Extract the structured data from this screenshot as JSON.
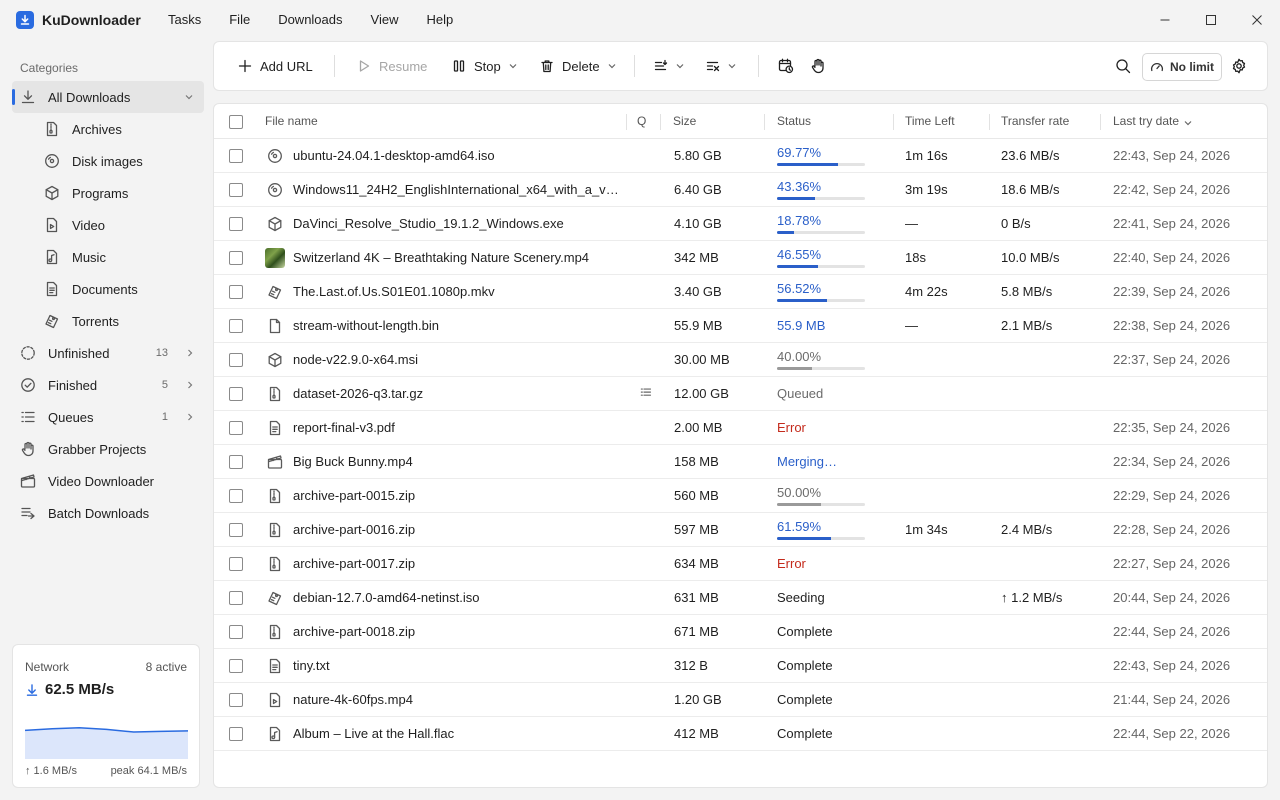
{
  "app": {
    "title": "KuDownloader"
  },
  "menu": [
    "Tasks",
    "File",
    "Downloads",
    "View",
    "Help"
  ],
  "sidebar": {
    "heading": "Categories",
    "items": [
      {
        "label": "All Downloads",
        "icon": "download-icon",
        "active": true,
        "expanded": true
      },
      {
        "label": "Archives",
        "icon": "archive-icon",
        "sub": true
      },
      {
        "label": "Disk images",
        "icon": "disc-icon",
        "sub": true
      },
      {
        "label": "Programs",
        "icon": "package-icon",
        "sub": true
      },
      {
        "label": "Video",
        "icon": "video-icon",
        "sub": true
      },
      {
        "label": "Music",
        "icon": "music-icon",
        "sub": true
      },
      {
        "label": "Documents",
        "icon": "document-icon",
        "sub": true
      },
      {
        "label": "Torrents",
        "icon": "torrent-icon",
        "sub": true
      },
      {
        "label": "Unfinished",
        "icon": "unfinished-icon",
        "count": "13",
        "chevron": true
      },
      {
        "label": "Finished",
        "icon": "check-circle-icon",
        "count": "5",
        "chevron": true
      },
      {
        "label": "Queues",
        "icon": "queue-icon",
        "count": "1",
        "chevron": true
      },
      {
        "label": "Grabber Projects",
        "icon": "grab-hand-icon"
      },
      {
        "label": "Video Downloader",
        "icon": "clapper-icon"
      },
      {
        "label": "Batch Downloads",
        "icon": "batch-icon"
      }
    ]
  },
  "network": {
    "title": "Network",
    "active": "8 active",
    "speed": "62.5 MB/s",
    "upload": "↑ 1.6 MB/s",
    "peak": "peak 64.1 MB/s",
    "graph": [
      0.55,
      0.58,
      0.6,
      0.57,
      0.52,
      0.53,
      0.54
    ],
    "accent": "#2a6be0"
  },
  "toolbar": {
    "add_url": "Add URL",
    "resume": "Resume",
    "stop": "Stop",
    "delete": "Delete",
    "speed_limit": "No limit"
  },
  "table": {
    "columns": {
      "name": "File name",
      "queue": "Q",
      "size": "Size",
      "status": "Status",
      "time_left": "Time Left",
      "rate": "Transfer rate",
      "date": "Last try date"
    },
    "rows": [
      {
        "name": "ubuntu-24.04.1-desktop-amd64.iso",
        "icon": "disc-icon",
        "size": "5.80 GB",
        "status": "69.77%",
        "kind": "progress",
        "progress": 0.6977,
        "time": "1m 16s",
        "rate": "23.6 MB/s",
        "date": "22:43, Sep 24, 2026"
      },
      {
        "name": "Windows11_24H2_EnglishInternational_x64_with_a_very…",
        "icon": "disc-icon",
        "size": "6.40 GB",
        "status": "43.36%",
        "kind": "progress",
        "progress": 0.4336,
        "time": "3m 19s",
        "rate": "18.6 MB/s",
        "date": "22:42, Sep 24, 2026"
      },
      {
        "name": "DaVinci_Resolve_Studio_19.1.2_Windows.exe",
        "icon": "package-icon",
        "size": "4.10 GB",
        "status": "18.78%",
        "kind": "progress",
        "progress": 0.1878,
        "time": "—",
        "rate": "0 B/s",
        "date": "22:41, Sep 24, 2026"
      },
      {
        "name": "Switzerland 4K – Breathtaking Nature Scenery.mp4",
        "icon": "video-thumbnail",
        "size": "342 MB",
        "status": "46.55%",
        "kind": "progress",
        "progress": 0.4655,
        "time": "18s",
        "rate": "10.0 MB/s",
        "date": "22:40, Sep 24, 2026"
      },
      {
        "name": "The.Last.of.Us.S01E01.1080p.mkv",
        "icon": "torrent-icon",
        "size": "3.40 GB",
        "status": "56.52%",
        "kind": "progress",
        "progress": 0.5652,
        "time": "4m 22s",
        "rate": "5.8 MB/s",
        "date": "22:39, Sep 24, 2026"
      },
      {
        "name": "stream-without-length.bin",
        "icon": "file-icon",
        "size": "55.9 MB",
        "status": "55.9 MB",
        "kind": "blue",
        "time": "—",
        "rate": "2.1 MB/s",
        "date": "22:38, Sep 24, 2026"
      },
      {
        "name": "node-v22.9.0-x64.msi",
        "icon": "package-icon",
        "size": "30.00 MB",
        "status": "40.00%",
        "kind": "paused",
        "progress": 0.4,
        "time": "",
        "rate": "",
        "date": "22:37, Sep 24, 2026"
      },
      {
        "name": "dataset-2026-q3.tar.gz",
        "icon": "archive-icon",
        "queued_icon": true,
        "size": "12.00 GB",
        "status": "Queued",
        "kind": "gray",
        "time": "",
        "rate": "",
        "date": ""
      },
      {
        "name": "report-final-v3.pdf",
        "icon": "document-icon",
        "size": "2.00 MB",
        "status": "Error",
        "kind": "red",
        "time": "",
        "rate": "",
        "date": "22:35, Sep 24, 2026"
      },
      {
        "name": "Big Buck Bunny.mp4",
        "icon": "clapper-icon",
        "size": "158 MB",
        "status": "Merging…",
        "kind": "blue",
        "time": "",
        "rate": "",
        "date": "22:34, Sep 24, 2026"
      },
      {
        "name": "archive-part-0015.zip",
        "icon": "archive-icon",
        "size": "560 MB",
        "status": "50.00%",
        "kind": "paused",
        "progress": 0.5,
        "time": "",
        "rate": "",
        "date": "22:29, Sep 24, 2026"
      },
      {
        "name": "archive-part-0016.zip",
        "icon": "archive-icon",
        "size": "597 MB",
        "status": "61.59%",
        "kind": "progress",
        "progress": 0.6159,
        "time": "1m 34s",
        "rate": "2.4 MB/s",
        "date": "22:28, Sep 24, 2026"
      },
      {
        "name": "archive-part-0017.zip",
        "icon": "archive-icon",
        "size": "634 MB",
        "status": "Error",
        "kind": "red",
        "time": "",
        "rate": "",
        "date": "22:27, Sep 24, 2026"
      },
      {
        "name": "debian-12.7.0-amd64-netinst.iso",
        "icon": "torrent-icon",
        "size": "631 MB",
        "status": "Seeding",
        "kind": "plain",
        "time": "",
        "rate": "↑ 1.2 MB/s",
        "date": "20:44, Sep 24, 2026"
      },
      {
        "name": "archive-part-0018.zip",
        "icon": "archive-icon",
        "size": "671 MB",
        "status": "Complete",
        "kind": "plain",
        "time": "",
        "rate": "",
        "date": "22:44, Sep 24, 2026"
      },
      {
        "name": "tiny.txt",
        "icon": "document-icon",
        "size": "312 B",
        "status": "Complete",
        "kind": "plain",
        "time": "",
        "rate": "",
        "date": "22:43, Sep 24, 2026"
      },
      {
        "name": "nature-4k-60fps.mp4",
        "icon": "video-icon",
        "size": "1.20 GB",
        "status": "Complete",
        "kind": "plain",
        "time": "",
        "rate": "",
        "date": "21:44, Sep 24, 2026"
      },
      {
        "name": "Album – Live at the Hall.flac",
        "icon": "music-icon",
        "size": "412 MB",
        "status": "Complete",
        "kind": "plain",
        "time": "",
        "rate": "",
        "date": "22:44, Sep 22, 2026"
      }
    ]
  }
}
